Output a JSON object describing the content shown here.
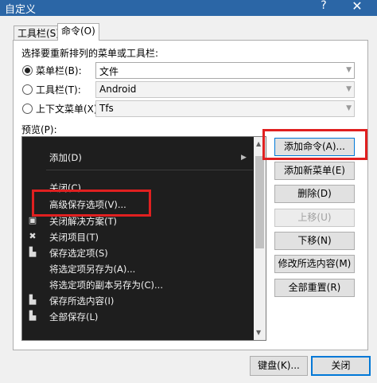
{
  "window": {
    "title": "自定义",
    "help_label": "?",
    "close_label": "✕"
  },
  "tabs": [
    {
      "label": "工具栏(S)"
    },
    {
      "label": "命令(O)"
    }
  ],
  "section_label": "选择要重新排列的菜单或工具栏:",
  "selectors": [
    {
      "label": "菜单栏(B):",
      "value": "文件",
      "selected": true
    },
    {
      "label": "工具栏(T):",
      "value": "Android",
      "selected": false
    },
    {
      "label": "上下文菜单(X):",
      "value": "Tfs",
      "selected": false
    }
  ],
  "preview_label": "预览(P):",
  "preview_items": [
    {
      "label": "添加(D)",
      "icon": "",
      "submenu_glyph": "▶"
    },
    {
      "label": "关闭(C)",
      "icon": ""
    },
    {
      "label": "高级保存选项(V)...",
      "icon": ""
    },
    {
      "label": "关闭解决方案(T)",
      "icon": "▣"
    },
    {
      "label": "关闭项目(T)",
      "icon": "✖"
    },
    {
      "label": "保存选定项(S)",
      "icon": "▙"
    },
    {
      "label": "将选定项另存为(A)...",
      "icon": ""
    },
    {
      "label": "将选定项的副本另存为(C)...",
      "icon": ""
    },
    {
      "label": "保存所选内容(I)",
      "icon": "▙"
    },
    {
      "label": "全部保存(L)",
      "icon": "▙"
    }
  ],
  "scroll": {
    "up": "▲",
    "down": "▼"
  },
  "buttons": {
    "add_command": "添加命令(A)...",
    "add_menu": "添加新菜单(E)",
    "delete": "删除(D)",
    "move_up": "上移(U)",
    "move_down": "下移(N)",
    "modify": "修改所选内容(M)",
    "reset_all": "全部重置(R)"
  },
  "footer": {
    "keyboard": "键盘(K)...",
    "close": "关闭"
  },
  "colors": {
    "titlebar": "#2b66a6",
    "highlight": "#e02020",
    "preview_bg": "#1e1e1e"
  }
}
